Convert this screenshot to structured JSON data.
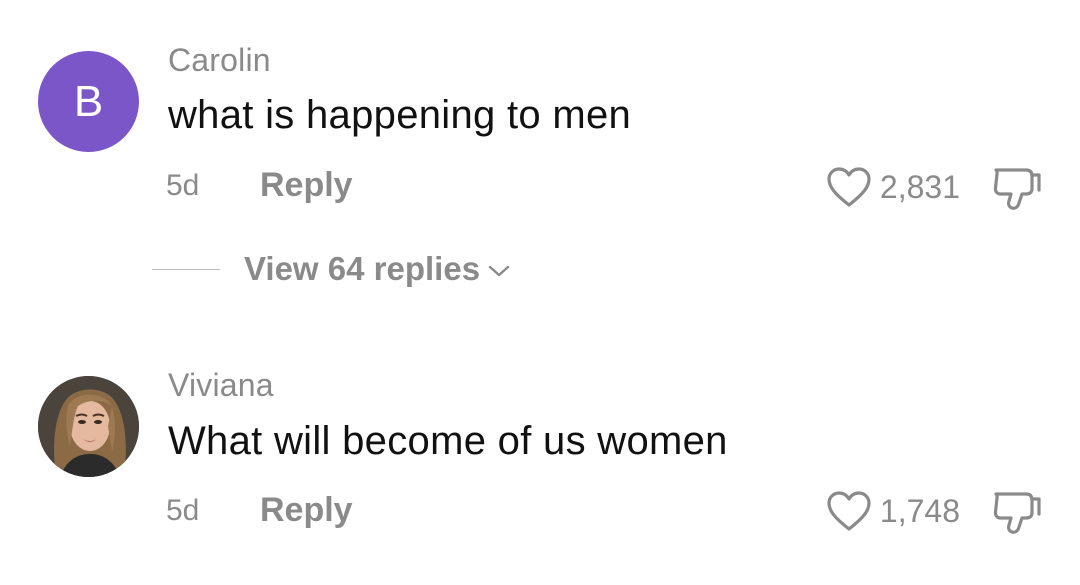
{
  "comments": [
    {
      "avatar_letter": "B",
      "avatar_color": "#7b56c9",
      "username": "Carolin",
      "text": "what is happening to men",
      "age": "5d",
      "reply_label": "Reply",
      "likes": "2,831",
      "view_replies": "View 64 replies"
    },
    {
      "username": "Viviana",
      "text": "What will become of us women",
      "age": "5d",
      "reply_label": "Reply",
      "likes": "1,748"
    }
  ],
  "icons": {
    "like": "heart-outline-icon",
    "dislike": "thumbs-down-outline-icon",
    "expand": "chevron-down-icon"
  },
  "colors": {
    "secondary_text": "#8a8a8a",
    "primary_text": "#111111",
    "avatar_purple": "#7b56c9"
  }
}
